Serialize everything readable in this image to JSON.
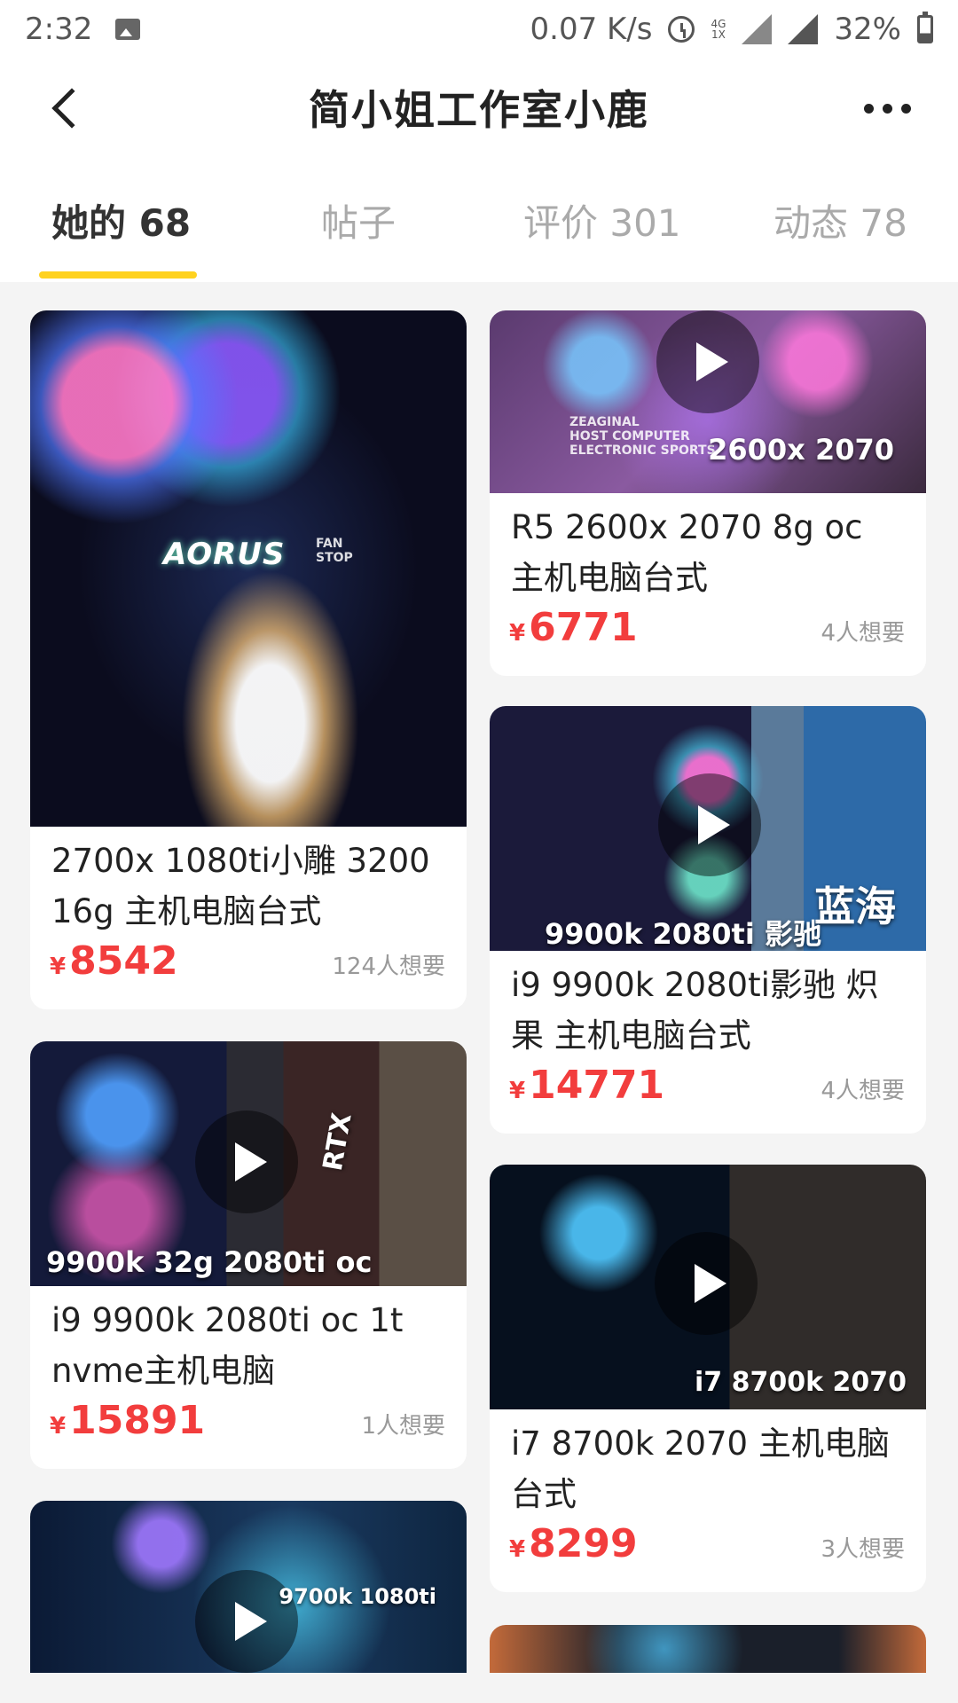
{
  "status_bar": {
    "time": "2:32",
    "speed": "0.07 K/s",
    "network_top": "4G",
    "network_bottom": "1X",
    "battery": "32%"
  },
  "header": {
    "title": "简小姐工作室小鹿"
  },
  "tabs": [
    {
      "label": "她的 68",
      "active": true
    },
    {
      "label": "帖子",
      "active": false
    },
    {
      "label": "评价 301",
      "active": false
    },
    {
      "label": "动态 78",
      "active": false
    }
  ],
  "colors": {
    "accent": "#ffd21f",
    "price": "#f23d3d"
  },
  "items": [
    {
      "title": "2700x 1080ti小雕 3200 16g 主机电脑台式",
      "currency": "¥",
      "price": "8542",
      "wants": "124人想要",
      "overlay": "",
      "brand": "AORUS",
      "brand_small": "FAN\nSTOP",
      "video": false
    },
    {
      "title": "R5 2600x 2070 8g oc 主机电脑台式",
      "currency": "¥",
      "price": "6771",
      "wants": "4人想要",
      "overlay": "2600x 2070",
      "brand_small": "ZEAGINAL\nHOST COMPUTER\nELECTRONIC SPORTS",
      "video": true
    },
    {
      "title": "i9 9900k 2080ti影驰 炽果 主机电脑台式",
      "currency": "¥",
      "price": "14771",
      "wants": "4人想要",
      "overlay": "9900k 2080ti 影驰",
      "box_text": "蓝海",
      "video": true
    },
    {
      "title": "i9 9900k 2080ti oc 1t nvme主机电脑",
      "currency": "¥",
      "price": "15891",
      "wants": "1人想要",
      "overlay": "9900k 32g 2080ti oc",
      "box_text": "RTX",
      "video": true
    },
    {
      "title": "i7 8700k 2070 主机电脑台式",
      "currency": "¥",
      "price": "8299",
      "wants": "3人想要",
      "overlay": "i7 8700k 2070",
      "video": true
    },
    {
      "overlay": "9700k 1080ti",
      "video": true
    }
  ]
}
